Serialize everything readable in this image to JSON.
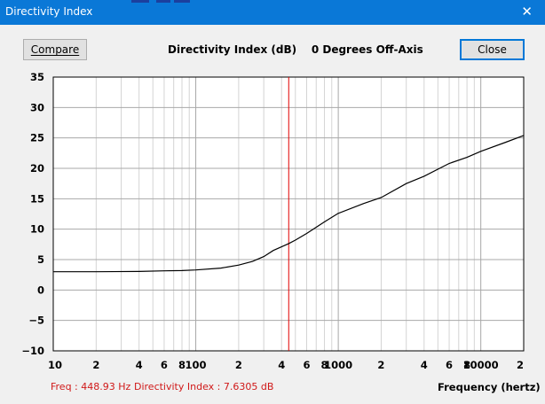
{
  "window": {
    "title": "Directivity Index",
    "close_glyph": "✕"
  },
  "toolbar": {
    "compare_label": "Compare",
    "close_label": "Close"
  },
  "chart_heading": "Directivity Index (dB)    0 Degrees Off-Axis",
  "status": {
    "freq": "Freq : 448.93 Hz",
    "directivity": "Directivity Index : 7.6305 dB"
  },
  "chart_data": {
    "type": "line",
    "xlabel": "Frequency (hertz)",
    "ylabel": "",
    "x_scale": "log",
    "xlim": [
      10,
      20000
    ],
    "ylim": [
      -10,
      35
    ],
    "y_ticks": [
      35,
      30,
      25,
      20,
      15,
      10,
      5,
      0,
      -5,
      -10
    ],
    "y_tick_labels": [
      "35",
      "30",
      "25",
      "20",
      "15",
      "10",
      "5",
      "0",
      "−5",
      "−10"
    ],
    "x_tick_labels": [
      {
        "x": 10,
        "label": "10"
      },
      {
        "x": 20,
        "label": "2"
      },
      {
        "x": 40,
        "label": "4"
      },
      {
        "x": 60,
        "label": "6"
      },
      {
        "x": 80,
        "label": "8"
      },
      {
        "x": 100,
        "label": "100"
      },
      {
        "x": 200,
        "label": "2"
      },
      {
        "x": 400,
        "label": "4"
      },
      {
        "x": 600,
        "label": "6"
      },
      {
        "x": 800,
        "label": "8"
      },
      {
        "x": 1000,
        "label": "1000"
      },
      {
        "x": 2000,
        "label": "2"
      },
      {
        "x": 4000,
        "label": "4"
      },
      {
        "x": 6000,
        "label": "6"
      },
      {
        "x": 8000,
        "label": "8"
      },
      {
        "x": 10000,
        "label": "10000"
      },
      {
        "x": 20000,
        "label": "2"
      }
    ],
    "grid": true,
    "cursor_x": 448.93,
    "series": [
      {
        "color": "#000000",
        "x": [
          10,
          20,
          40,
          60,
          80,
          100,
          150,
          200,
          250,
          300,
          350,
          400,
          448.93,
          500,
          600,
          800,
          1000,
          1500,
          2000,
          3000,
          4000,
          6000,
          8000,
          10000,
          15000,
          20000
        ],
        "y": [
          3.0,
          3.0,
          3.05,
          3.15,
          3.2,
          3.3,
          3.6,
          4.1,
          4.7,
          5.5,
          6.5,
          7.1,
          7.63,
          8.2,
          9.3,
          11.2,
          12.6,
          14.2,
          15.2,
          17.5,
          18.7,
          20.8,
          21.8,
          22.8,
          24.3,
          25.4
        ]
      }
    ]
  },
  "colors": {
    "title_bar": "#0a78d7",
    "cursor": "#e00000",
    "status_text": "#d01818",
    "grid_major": "#a8a8a8",
    "grid_minor": "#d4d4d4"
  }
}
